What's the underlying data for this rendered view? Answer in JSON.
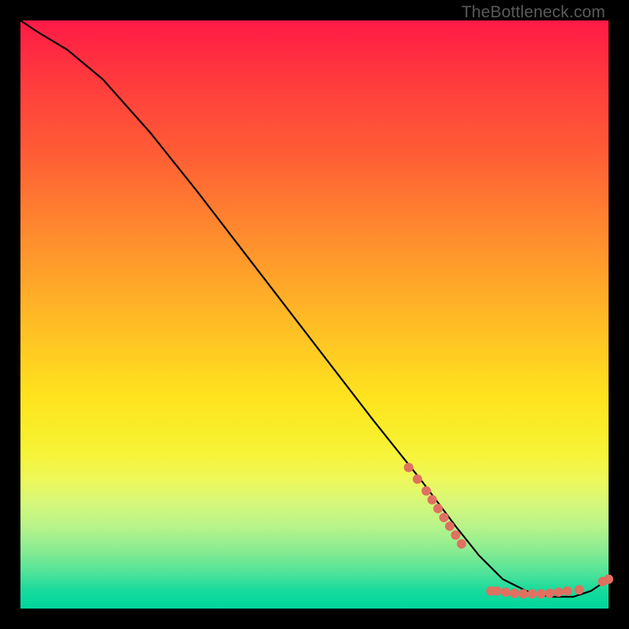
{
  "watermark": "TheBottleneck.com",
  "chart_data": {
    "type": "line",
    "title": "",
    "xlabel": "",
    "ylabel": "",
    "xlim": [
      0,
      100
    ],
    "ylim": [
      0,
      100
    ],
    "grid": false,
    "series": [
      {
        "name": "curve",
        "color": "#000000",
        "x": [
          0,
          3,
          8,
          14,
          22,
          30,
          40,
          50,
          60,
          68,
          74,
          78,
          82,
          86,
          90,
          94,
          97,
          100
        ],
        "values": [
          100,
          98,
          95,
          90,
          81,
          71,
          58,
          45,
          32,
          22,
          14,
          9,
          5,
          3,
          2,
          2,
          3,
          5
        ]
      }
    ],
    "dot_clusters": [
      {
        "color": "#e07060",
        "radius": 6,
        "points": [
          [
            66,
            24
          ],
          [
            67.5,
            22
          ],
          [
            69,
            20
          ],
          [
            70,
            18.5
          ],
          [
            71,
            17
          ],
          [
            72,
            15.5
          ],
          [
            73,
            14
          ],
          [
            74,
            12.5
          ],
          [
            75,
            11
          ]
        ]
      },
      {
        "color": "#e07060",
        "radius": 6,
        "points": [
          [
            80,
            3
          ],
          [
            81,
            3
          ],
          [
            82.5,
            2.8
          ],
          [
            84,
            2.6
          ],
          [
            85.5,
            2.5
          ],
          [
            87,
            2.5
          ],
          [
            88.5,
            2.5
          ],
          [
            90,
            2.6
          ],
          [
            91.5,
            2.8
          ],
          [
            93,
            3
          ],
          [
            95,
            3.2
          ]
        ]
      },
      {
        "color": "#e07060",
        "radius": 6,
        "points": [
          [
            99,
            4.6
          ],
          [
            100,
            5
          ]
        ]
      }
    ]
  }
}
